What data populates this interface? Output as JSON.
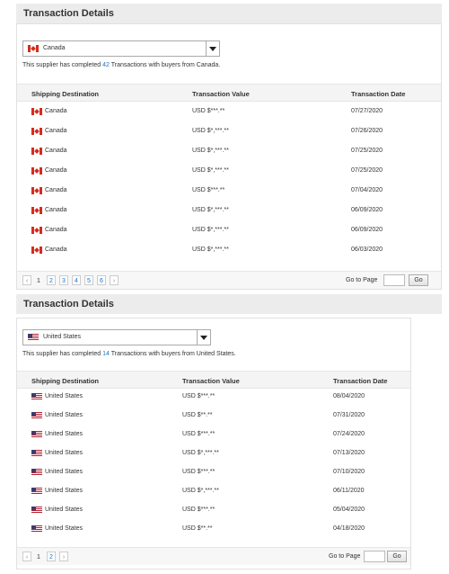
{
  "panels": [
    {
      "title": "Transaction Details",
      "country": "Canada",
      "flag": "canada-flag-icon",
      "summary_prefix": "This supplier has completed",
      "count": "42",
      "summary_suffix": "Transactions with buyers from Canada.",
      "columns": [
        "Shipping Destination",
        "Transaction Value",
        "Transaction Date"
      ],
      "rows": [
        {
          "destination": "Canada",
          "value": "USD $***.**",
          "date": "07/27/2020"
        },
        {
          "destination": "Canada",
          "value": "USD $*,***.**",
          "date": "07/26/2020"
        },
        {
          "destination": "Canada",
          "value": "USD $*,***.**",
          "date": "07/25/2020"
        },
        {
          "destination": "Canada",
          "value": "USD $*,***.**",
          "date": "07/25/2020"
        },
        {
          "destination": "Canada",
          "value": "USD $***.**",
          "date": "07/04/2020"
        },
        {
          "destination": "Canada",
          "value": "USD $*,***.**",
          "date": "06/09/2020"
        },
        {
          "destination": "Canada",
          "value": "USD $*,***.**",
          "date": "06/09/2020"
        },
        {
          "destination": "Canada",
          "value": "USD $*,***.**",
          "date": "06/03/2020"
        }
      ],
      "pages": [
        "1",
        "2",
        "3",
        "4",
        "5",
        "6"
      ],
      "prev": "‹",
      "next": "›",
      "goto_label": "Go to Page",
      "go_label": "Go"
    },
    {
      "title": "Transaction Details",
      "country": "United States",
      "flag": "us-flag-icon",
      "summary_prefix": "This supplier has completed",
      "count": "14",
      "summary_suffix": "Transactions with buyers from United States.",
      "columns": [
        "Shipping Destination",
        "Transaction Value",
        "Transaction Date"
      ],
      "rows": [
        {
          "destination": "United States",
          "value": "USD $***.**",
          "date": "08/04/2020"
        },
        {
          "destination": "United States",
          "value": "USD $**.**",
          "date": "07/31/2020"
        },
        {
          "destination": "United States",
          "value": "USD $***.**",
          "date": "07/24/2020"
        },
        {
          "destination": "United States",
          "value": "USD $*,***.**",
          "date": "07/13/2020"
        },
        {
          "destination": "United States",
          "value": "USD $***.**",
          "date": "07/10/2020"
        },
        {
          "destination": "United States",
          "value": "USD $*,***.**",
          "date": "06/11/2020"
        },
        {
          "destination": "United States",
          "value": "USD $***.**",
          "date": "05/04/2020"
        },
        {
          "destination": "United States",
          "value": "USD $**.**",
          "date": "04/18/2020"
        }
      ],
      "pages": [
        "1",
        "2"
      ],
      "prev": "‹",
      "next": "›",
      "goto_label": "Go to Page",
      "go_label": "Go"
    }
  ]
}
